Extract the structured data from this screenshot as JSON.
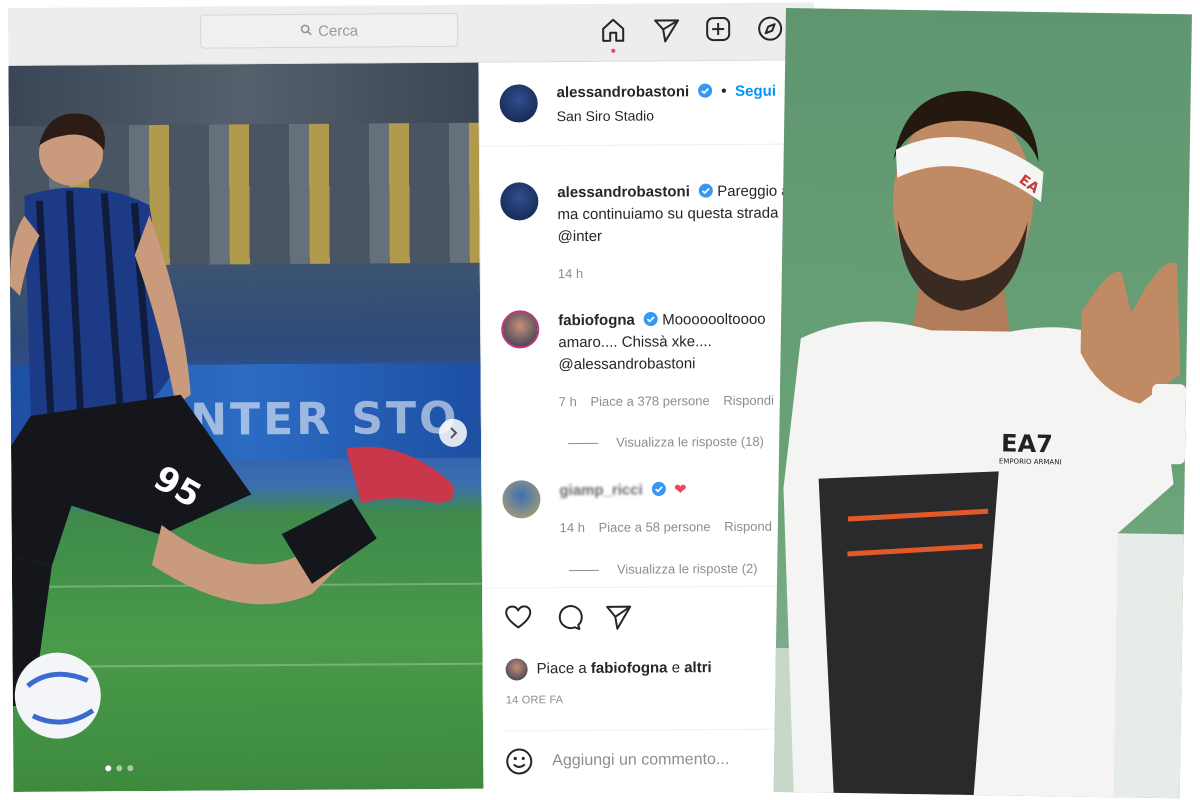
{
  "search": {
    "placeholder": "Cerca"
  },
  "nav": {
    "icons": [
      "home-icon",
      "direct-icon",
      "new-post-icon",
      "explore-icon"
    ]
  },
  "photo": {
    "board_text": "INTER STO",
    "jersey_number": "95",
    "carousel": {
      "current": 1,
      "total": 3
    }
  },
  "post": {
    "author": "alessandrobastoni",
    "separator": "•",
    "follow_label": "Segui",
    "location": "San Siro Stadio",
    "caption": {
      "username": "alessandrobastoni",
      "text_line1": "Pareggio am",
      "text_line2": "ma continuiamo su questa strada",
      "mention": "@inter",
      "time": "14 h"
    },
    "comments": [
      {
        "username": "fabiofogna",
        "text_line1": "Mooooooltoooo",
        "text_line2": "amaro.... Chissà xke....",
        "mention": "@alessandrobastoni",
        "time": "7 h",
        "likes": "Piace a 378 persone",
        "reply": "Rispondi",
        "view_replies": "Visualizza le risposte (18)"
      },
      {
        "username": "giamp_ricci",
        "text": "❤",
        "time": "14 h",
        "likes": "Piace a 58 persone",
        "reply": "Rispond",
        "view_replies": "Visualizza le risposte (2)"
      }
    ],
    "liked_by": {
      "prefix": "Piace a",
      "user": "fabiofogna",
      "conj": "e",
      "others": "altri"
    },
    "timestamp": "14 ORE FA",
    "add_comment_placeholder": "Aggiungi un commento..."
  },
  "tennis_photo": {
    "headband_text": "EA",
    "shirt_logo": "EA7",
    "shirt_sub": "EMPORIO ARMANI"
  },
  "colors": {
    "accent_blue": "#0095f6",
    "verified_blue": "#3897f0",
    "heart_red": "#ed4956",
    "link": "#00376b"
  }
}
